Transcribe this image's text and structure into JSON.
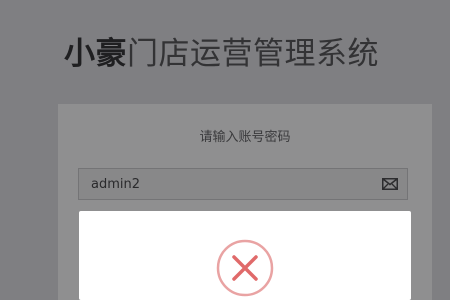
{
  "header": {
    "brand": "小豪",
    "title_rest": "门店运营管理系统"
  },
  "login": {
    "subtitle": "请输入账号密码",
    "username_value": "admin2"
  },
  "icons": {
    "username_icon": "mail-icon",
    "dialog_icon": "error-x-circle-icon"
  },
  "colors": {
    "error": "#e06a6a",
    "overlay": "#7f7f82"
  }
}
